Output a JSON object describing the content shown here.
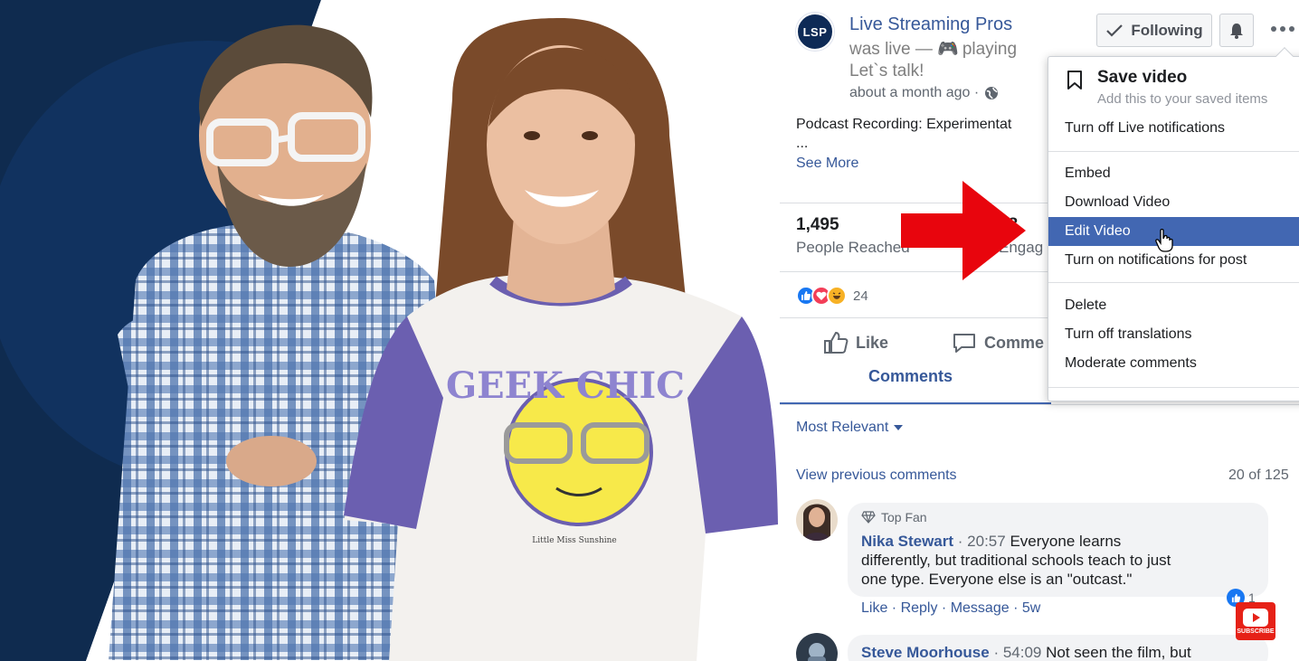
{
  "post": {
    "page_name": "Live Streaming Pros",
    "avatar_initials": "LSP",
    "status_prefix": "was live — ",
    "status_activity": "playing",
    "status_subject": "Let`s talk!",
    "time": "about a month ago ·",
    "text": "Podcast Recording: Experimentat",
    "ellipsis": "...",
    "see_more": "See More"
  },
  "header_buttons": {
    "following": "Following"
  },
  "stats": {
    "reached_value": "1,495",
    "reached_label": "People Reached",
    "engaged_value": "88",
    "engaged_label": "Engag"
  },
  "reactions": {
    "count": "24",
    "icons": [
      "like-icon",
      "love-icon",
      "haha-icon"
    ]
  },
  "actions": {
    "like": "Like",
    "comment": "Comme",
    "comments_tab": "Comments"
  },
  "comments_section": {
    "sort_label": "Most Relevant",
    "view_previous": "View previous comments",
    "count_of": "20 of 125",
    "items": [
      {
        "badge": "Top Fan",
        "author": "Nika Stewart",
        "timestamp": "· 20:57",
        "body_line1": "Everyone learns",
        "body_line2": "differently, but traditional schools teach to just",
        "body_line3": "one type. Everyone else is an \"outcast.\"",
        "actions": "Like · Reply · Message · 5w",
        "likes": "1"
      },
      {
        "author": "Steve Moorhouse",
        "timestamp": "· 54:09",
        "body_line1": "Not seen the film, but"
      }
    ]
  },
  "menu": {
    "save_title": "Save video",
    "save_subtitle": "Add this to your saved items",
    "items": [
      "Turn off Live notifications",
      "Embed",
      "Download Video",
      "Edit Video",
      "Turn on notifications for post",
      "Delete",
      "Turn off translations",
      "Moderate comments"
    ],
    "highlighted": "Edit Video"
  },
  "video": {
    "shirt_text": "GEEK CHIC",
    "shirt_caption": "Little Miss Sunshine"
  },
  "youtube": {
    "label": "SUBSCRIBE"
  },
  "colors": {
    "navy": "#0f2b4f",
    "fb_blue": "#365899",
    "menu_highlight": "#4267b2",
    "arrow_red": "#e8050d",
    "youtube_red": "#e62117"
  }
}
